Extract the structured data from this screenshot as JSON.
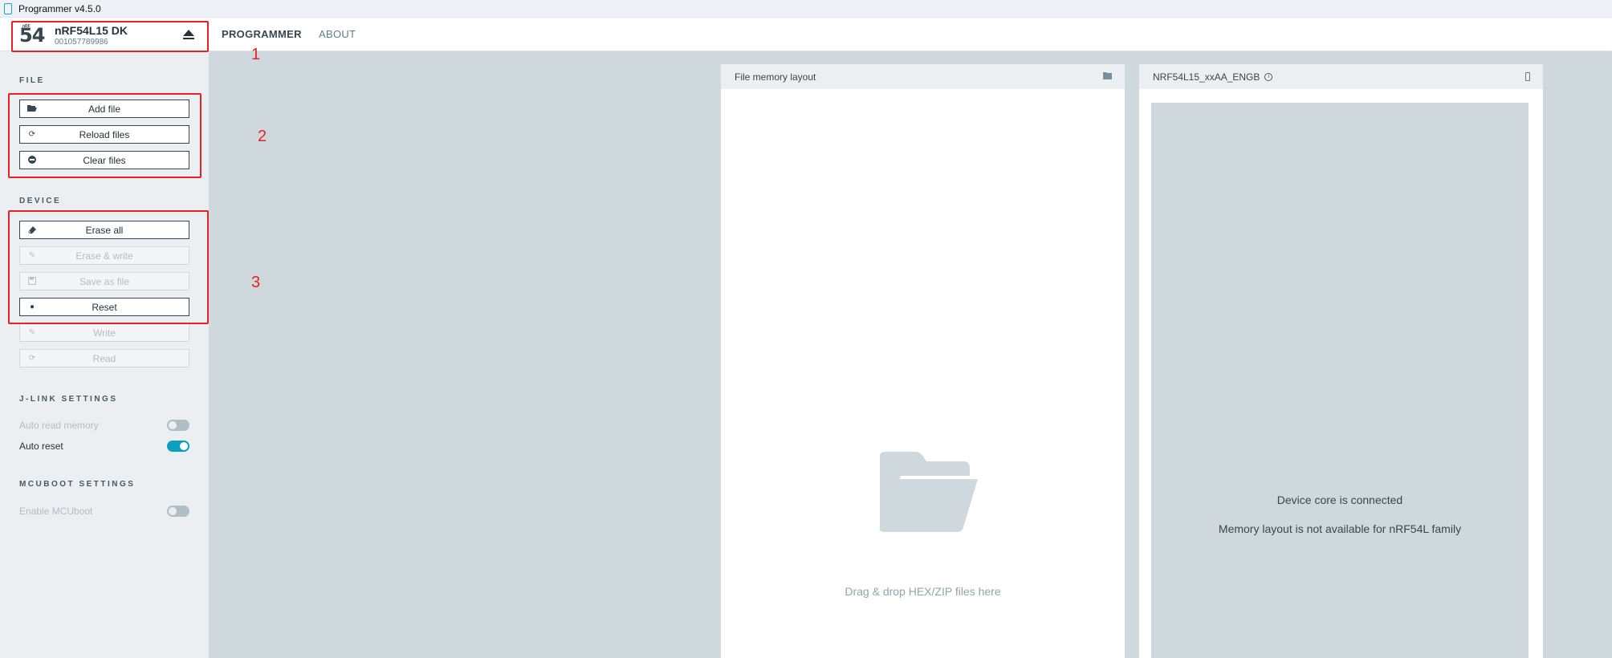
{
  "window": {
    "title": "Programmer v4.5.0"
  },
  "device": {
    "logo_number": "54",
    "logo_small": "nRF",
    "name": "nRF54L15 DK",
    "serial": "001057789986"
  },
  "nav": {
    "tabs": [
      {
        "label": "PROGRAMMER"
      },
      {
        "label": "ABOUT"
      }
    ]
  },
  "sidebar": {
    "file_title": "FILE",
    "file_buttons": [
      {
        "label": "Add file",
        "icon": "folder-open-icon"
      },
      {
        "label": "Reload files",
        "icon": "refresh-icon"
      },
      {
        "label": "Clear files",
        "icon": "minus-circle-icon"
      }
    ],
    "device_title": "DEVICE",
    "device_buttons": [
      {
        "label": "Erase all",
        "icon": "eraser-icon",
        "enabled": true
      },
      {
        "label": "Erase & write",
        "icon": "pencil-icon",
        "enabled": false
      },
      {
        "label": "Save as file",
        "icon": "save-icon",
        "enabled": false
      },
      {
        "label": "Reset",
        "icon": "dot-icon",
        "enabled": true
      },
      {
        "label": "Write",
        "icon": "pencil-icon",
        "enabled": false
      },
      {
        "label": "Read",
        "icon": "refresh-icon",
        "enabled": false
      }
    ],
    "jlink_title": "J-LINK SETTINGS",
    "jlink_settings": [
      {
        "label": "Auto read memory",
        "on": false
      },
      {
        "label": "Auto reset",
        "on": true
      }
    ],
    "mcuboot_title": "MCUBOOT SETTINGS",
    "mcuboot_settings": [
      {
        "label": "Enable MCUboot",
        "on": false
      }
    ]
  },
  "file_panel": {
    "title": "File memory layout",
    "drop_text": "Drag & drop HEX/ZIP files here"
  },
  "device_panel": {
    "title": "NRF54L15_xxAA_ENGB",
    "line1": "Device core is connected",
    "line2": "Memory layout is not available for nRF54L family"
  },
  "annotations": {
    "labels": [
      "1",
      "2",
      "3"
    ],
    "color": "#e8202a"
  },
  "colors": {
    "accent": "#0b9fc0",
    "sidebar_bg": "#eceff1",
    "main_bg": "#cfd8dc"
  }
}
